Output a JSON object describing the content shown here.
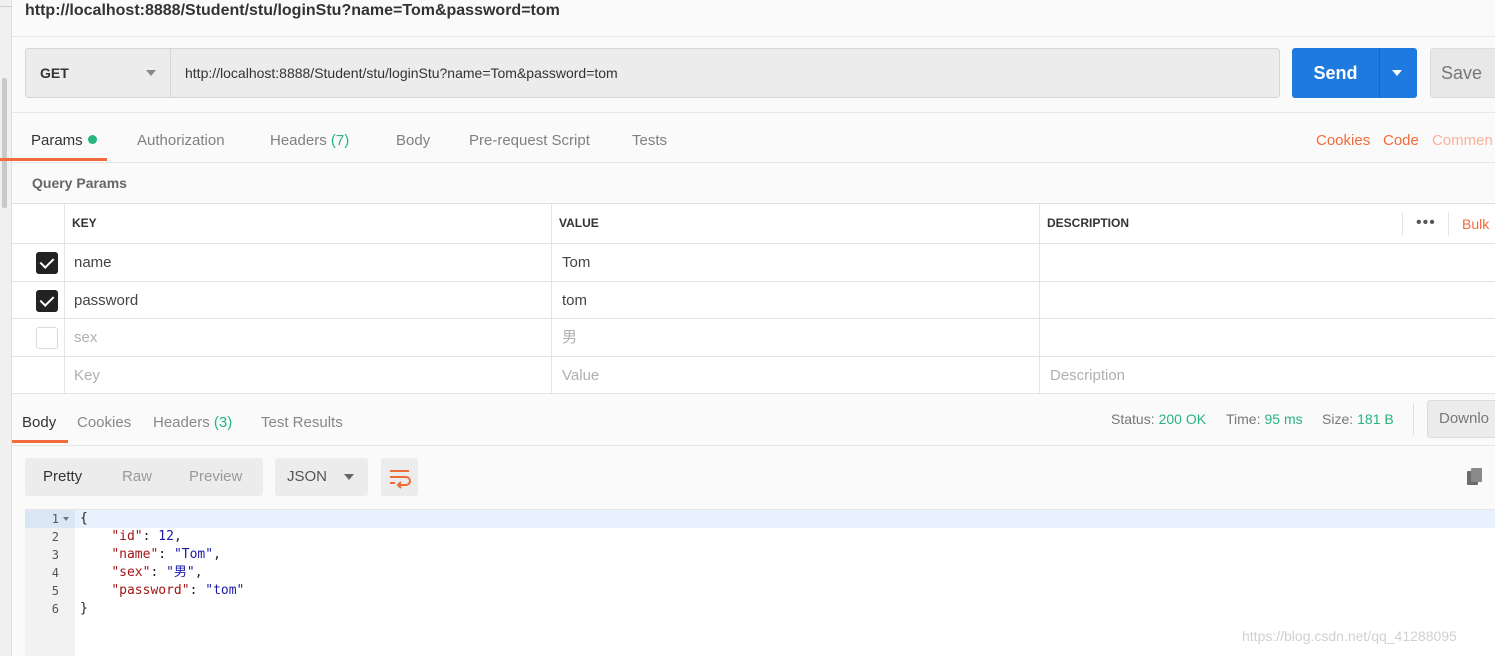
{
  "request": {
    "title": "http://localhost:8888/Student/stu/loginStu?name=Tom&password=tom",
    "method": "GET",
    "url": "http://localhost:8888/Student/stu/loginStu?name=Tom&password=tom",
    "send_label": "Send",
    "save_label": "Save"
  },
  "request_tabs": {
    "params": "Params",
    "authorization": "Authorization",
    "headers": "Headers",
    "headers_count": "(7)",
    "body": "Body",
    "prerequest": "Pre-request Script",
    "tests": "Tests",
    "cookies": "Cookies",
    "code": "Code",
    "comments": "Commen"
  },
  "query_params": {
    "title": "Query Params",
    "columns": {
      "key": "KEY",
      "value": "VALUE",
      "description": "DESCRIPTION"
    },
    "bulk": "Bulk",
    "rows": [
      {
        "checked": true,
        "key": "name",
        "value": "Tom",
        "description": ""
      },
      {
        "checked": true,
        "key": "password",
        "value": "tom",
        "description": ""
      },
      {
        "checked": false,
        "key": "sex",
        "value": "男",
        "description": ""
      }
    ],
    "placeholders": {
      "key": "Key",
      "value": "Value",
      "description": "Description"
    }
  },
  "response_tabs": {
    "body": "Body",
    "cookies": "Cookies",
    "headers": "Headers",
    "headers_count": "(3)",
    "test_results": "Test Results"
  },
  "response_status": {
    "status_label": "Status:",
    "status_value": "200 OK",
    "time_label": "Time:",
    "time_value": "95 ms",
    "size_label": "Size:",
    "size_value": "181 B",
    "download": "Downlo"
  },
  "format": {
    "pretty": "Pretty",
    "raw": "Raw",
    "preview": "Preview",
    "type": "JSON"
  },
  "response_body": {
    "line_numbers": [
      "1",
      "2",
      "3",
      "4",
      "5",
      "6"
    ],
    "open_brace": "{",
    "close_brace": "}",
    "fields": [
      {
        "key": "\"id\"",
        "value": "12",
        "trail": ","
      },
      {
        "key": "\"name\"",
        "value": "\"Tom\"",
        "trail": ","
      },
      {
        "key": "\"sex\"",
        "value": "\"男\"",
        "trail": ","
      },
      {
        "key": "\"password\"",
        "value": "\"tom\"",
        "trail": ""
      }
    ]
  },
  "watermark": "https://blog.csdn.net/qq_41288095",
  "colors": {
    "accent": "#f26b3a",
    "send": "#1f7ae0",
    "success": "#26b47f"
  }
}
